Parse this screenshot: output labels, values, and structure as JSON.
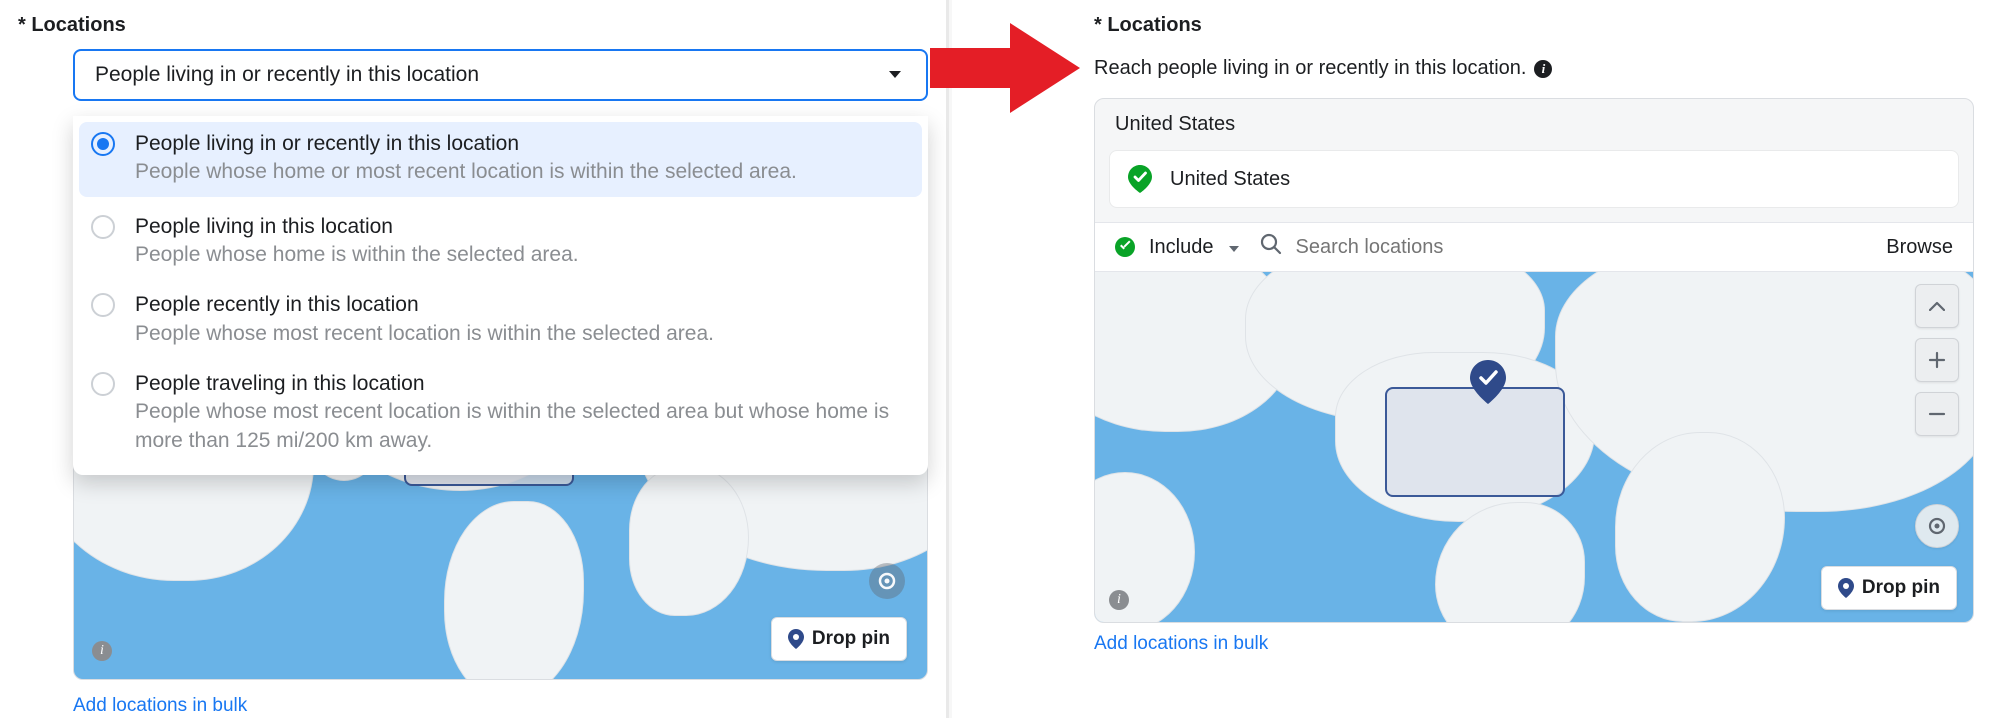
{
  "left": {
    "heading": "* Locations",
    "select_value": "People living in or recently in this location",
    "options": [
      {
        "label": "People living in or recently in this location",
        "desc": "People whose home or most recent location is within the selected area."
      },
      {
        "label": "People living in this location",
        "desc": "People whose home is within the selected area."
      },
      {
        "label": "People recently in this location",
        "desc": "People whose most recent location is within the selected area."
      },
      {
        "label": "People traveling in this location",
        "desc": "People whose most recent location is within the selected area but whose home is more than 125 mi/200 km away."
      }
    ],
    "drop_pin": "Drop pin",
    "bulk": "Add locations in bulk"
  },
  "right": {
    "heading": "* Locations",
    "reach": "Reach people living in or recently in this location.",
    "country_header": "United States",
    "country_chip": "United States",
    "include": "Include",
    "search_placeholder": "Search locations",
    "browse": "Browse",
    "drop_pin": "Drop pin",
    "bulk": "Add locations in bulk"
  },
  "icons": {
    "caret": "caret-down-icon",
    "search": "search-icon",
    "pin": "pin-icon",
    "info": "info-icon",
    "target": "target-icon",
    "chevron_up": "chevron-up-icon",
    "plus": "plus-icon",
    "minus": "minus-icon"
  },
  "colors": {
    "blue": "#1877f2",
    "green": "#09a327",
    "red": "#e41e26",
    "land": "#f0f3f5",
    "water": "#69b3e7",
    "navy": "#2f4a8a"
  }
}
